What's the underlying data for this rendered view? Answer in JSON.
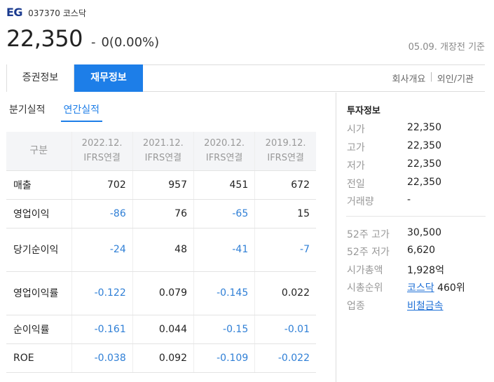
{
  "header": {
    "name": "EG",
    "code": "037370",
    "market": "코스닥"
  },
  "quote": {
    "price": "22,350",
    "change_sign": "-",
    "change": "0(0.00%)",
    "time_note": "05.09. 개장전 기준"
  },
  "tabs": [
    {
      "label": "증권정보",
      "active": false
    },
    {
      "label": "재무정보",
      "active": true
    }
  ],
  "tab_links": [
    "회사개요",
    "외인/기관"
  ],
  "subtabs": [
    {
      "label": "분기실적",
      "active": false
    },
    {
      "label": "연간실적",
      "active": true
    }
  ],
  "table": {
    "header_label": "구분",
    "columns": [
      {
        "period": "2022.12.",
        "basis": "IFRS연결"
      },
      {
        "period": "2021.12.",
        "basis": "IFRS연결"
      },
      {
        "period": "2020.12.",
        "basis": "IFRS연결"
      },
      {
        "period": "2019.12.",
        "basis": "IFRS연결"
      }
    ],
    "rows": [
      {
        "label": "매출",
        "values": [
          "702",
          "957",
          "451",
          "672"
        ]
      },
      {
        "label": "영업이익",
        "values": [
          "-86",
          "76",
          "-65",
          "15"
        ]
      },
      {
        "label": "당기순이익",
        "values": [
          "-24",
          "48",
          "-41",
          "-7"
        ]
      },
      {
        "label": "영업이익률",
        "values": [
          "-0.122",
          "0.079",
          "-0.145",
          "0.022"
        ]
      },
      {
        "label": "순이익률",
        "values": [
          "-0.161",
          "0.044",
          "-0.15",
          "-0.01"
        ]
      },
      {
        "label": "ROE",
        "values": [
          "-0.038",
          "0.092",
          "-0.109",
          "-0.022"
        ]
      }
    ]
  },
  "investment": {
    "title": "투자정보",
    "items": [
      {
        "k": "시가",
        "v": "22,350"
      },
      {
        "k": "고가",
        "v": "22,350"
      },
      {
        "k": "저가",
        "v": "22,350"
      },
      {
        "k": "전일",
        "v": "22,350"
      },
      {
        "k": "거래량",
        "v": "-"
      }
    ],
    "items2": [
      {
        "k": "52주 고가",
        "v": "30,500"
      },
      {
        "k": "52주 저가",
        "v": "6,620"
      },
      {
        "k": "시가총액",
        "v": "1,928억"
      }
    ],
    "rank": {
      "k": "시총순위",
      "market_link": "코스닥",
      "rank": "460위"
    },
    "sector": {
      "k": "업종",
      "link": "비철금속"
    }
  },
  "colors": {
    "accent": "#1d7ee8",
    "negative": "#2f7fd6",
    "brand": "#1a3a8f"
  }
}
